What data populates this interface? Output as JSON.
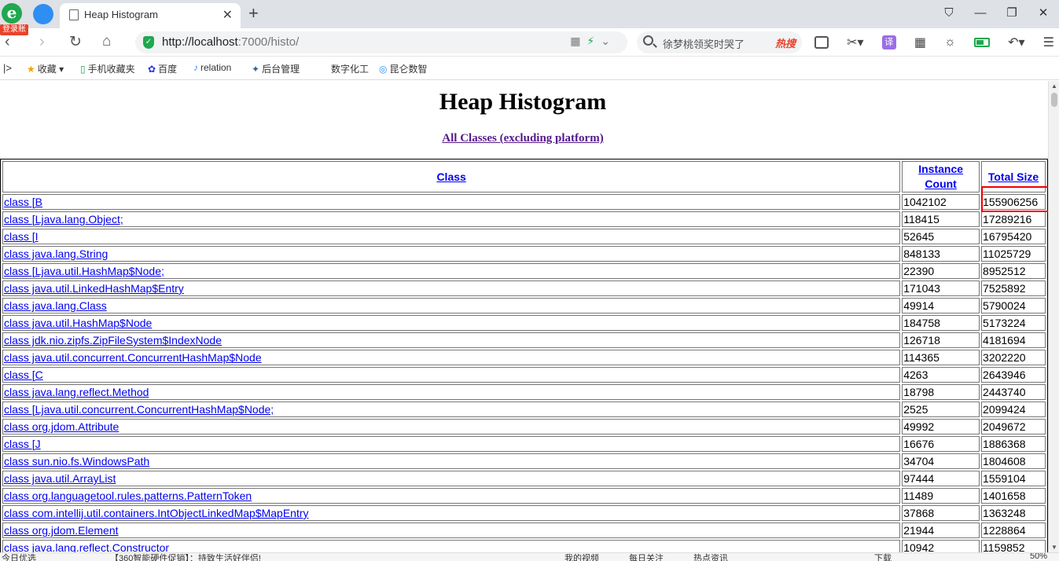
{
  "browser": {
    "login_badge": "登录账号",
    "tab_title": "Heap Histogram",
    "url_host": "http://localhost",
    "url_rest": ":7000/histo/",
    "search_text": "徐梦桃领奖时哭了",
    "hot_label": "热搜"
  },
  "bookmarks": [
    {
      "icon": "★",
      "label": "收藏",
      "color": "#f0a500"
    },
    {
      "icon": "▯",
      "label": "手机收藏夹",
      "color": "#1fa84f"
    },
    {
      "icon": "✿",
      "label": "百度",
      "color": "#2932e1"
    },
    {
      "icon": "♪",
      "label": "relation",
      "color": "#2f8ef2"
    },
    {
      "icon": "✦",
      "label": "后台管理",
      "color": "#336699"
    },
    {
      "icon": "",
      "label": "数字化工",
      "color": "#333"
    },
    {
      "icon": "◎",
      "label": "昆仑数智",
      "color": "#2f8ef2"
    }
  ],
  "page": {
    "heading": "Heap Histogram",
    "all_classes_link": "All Classes (excluding platform)",
    "columns": [
      "Class",
      "Instance Count",
      "Total Size"
    ],
    "rows": [
      {
        "cls": "class [B",
        "count": "1042102",
        "size": "155906256"
      },
      {
        "cls": "class [Ljava.lang.Object;",
        "count": "118415",
        "size": "17289216"
      },
      {
        "cls": "class [I",
        "count": "52645",
        "size": "16795420"
      },
      {
        "cls": "class java.lang.String",
        "count": "848133",
        "size": "11025729"
      },
      {
        "cls": "class [Ljava.util.HashMap$Node;",
        "count": "22390",
        "size": "8952512"
      },
      {
        "cls": "class java.util.LinkedHashMap$Entry",
        "count": "171043",
        "size": "7525892"
      },
      {
        "cls": "class java.lang.Class",
        "count": "49914",
        "size": "5790024"
      },
      {
        "cls": "class java.util.HashMap$Node",
        "count": "184758",
        "size": "5173224"
      },
      {
        "cls": "class jdk.nio.zipfs.ZipFileSystem$IndexNode",
        "count": "126718",
        "size": "4181694"
      },
      {
        "cls": "class java.util.concurrent.ConcurrentHashMap$Node",
        "count": "114365",
        "size": "3202220"
      },
      {
        "cls": "class [C",
        "count": "4263",
        "size": "2643946"
      },
      {
        "cls": "class java.lang.reflect.Method",
        "count": "18798",
        "size": "2443740"
      },
      {
        "cls": "class [Ljava.util.concurrent.ConcurrentHashMap$Node;",
        "count": "2525",
        "size": "2099424"
      },
      {
        "cls": "class org.jdom.Attribute",
        "count": "49992",
        "size": "2049672"
      },
      {
        "cls": "class [J",
        "count": "16676",
        "size": "1886368"
      },
      {
        "cls": "class sun.nio.fs.WindowsPath",
        "count": "34704",
        "size": "1804608"
      },
      {
        "cls": "class java.util.ArrayList",
        "count": "97444",
        "size": "1559104"
      },
      {
        "cls": "class org.languagetool.rules.patterns.PatternToken",
        "count": "11489",
        "size": "1401658"
      },
      {
        "cls": "class com.intellij.util.containers.IntObjectLinkedMap$MapEntry",
        "count": "37868",
        "size": "1363248"
      },
      {
        "cls": "class org.jdom.Element",
        "count": "21944",
        "size": "1228864"
      },
      {
        "cls": "class java.lang.reflect.Constructor",
        "count": "10942",
        "size": "1159852"
      }
    ]
  },
  "statusbar": {
    "items": [
      "今日优选",
      "【360智能硬件促销】：持致生活好伴侣!",
      "我的视频",
      "每日关注",
      "热点资讯",
      "下载",
      "50%"
    ]
  }
}
